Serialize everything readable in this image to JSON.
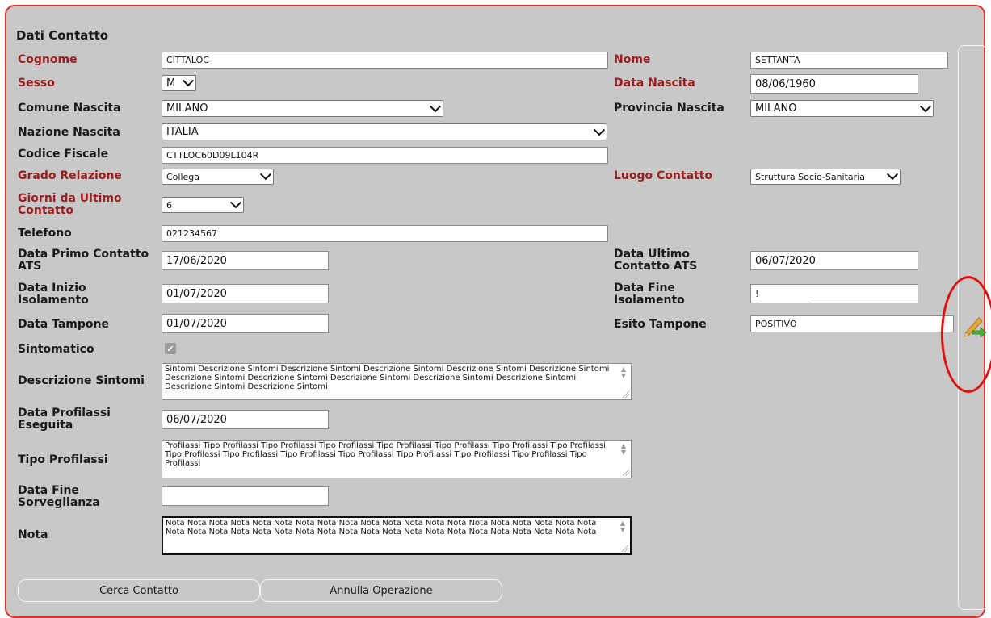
{
  "form": {
    "title": "Dati Contatto",
    "labels": {
      "cognome": "Cognome",
      "nome": "Nome",
      "sesso": "Sesso",
      "data_nascita": "Data Nascita",
      "comune_nascita": "Comune Nascita",
      "provincia_nascita": "Provincia Nascita",
      "nazione_nascita": "Nazione Nascita",
      "codice_fiscale": "Codice Fiscale",
      "grado_relazione": "Grado Relazione",
      "luogo_contatto": "Luogo Contatto",
      "giorni_ultimo_1": "Giorni da Ultimo",
      "giorni_ultimo_2": "Contatto",
      "telefono": "Telefono",
      "data_primo_1": "Data Primo Contatto",
      "data_primo_2": "ATS",
      "data_ultimo_1": "Data Ultimo",
      "data_ultimo_2": "Contatto ATS",
      "data_inizio_1": "Data Inizio",
      "data_inizio_2": "Isolamento",
      "data_fine_1": "Data Fine",
      "data_fine_2": "Isolamento",
      "data_tampone": "Data Tampone",
      "esito_tampone": "Esito Tampone",
      "sintomatico": "Sintomatico",
      "descrizione_sintomi": "Descrizione Sintomi",
      "data_profilassi_1": "Data Profilassi",
      "data_profilassi_2": "Eseguita",
      "tipo_profilassi": "Tipo Profilassi",
      "data_fine_sorv_1": "Data Fine",
      "data_fine_sorv_2": "Sorveglianza",
      "nota": "Nota"
    },
    "values": {
      "cognome": "CITTALOC",
      "nome": "SETTANTA",
      "sesso": "M",
      "data_nascita": "08/06/1960",
      "comune_nascita": "MILANO",
      "provincia_nascita": "MILANO",
      "nazione_nascita": "ITALIA",
      "codice_fiscale": "CTTLOC60D09L104R",
      "grado_relazione": "Collega",
      "luogo_contatto": "Struttura Socio-Sanitaria",
      "giorni_ultimo_contatto": "6",
      "telefono": "021234567",
      "data_primo_contatto": "17/06/2020",
      "data_ultimo_contatto": "06/07/2020",
      "data_inizio_isolamento": "01/07/2020",
      "data_fine_isolamento": "!",
      "data_tampone": "01/07/2020",
      "esito_tampone": "POSITIVO",
      "sintomatico_check": "✔",
      "descrizione_sintomi": "Sintomi Descrizione Sintomi Descrizione Sintomi Descrizione Sintomi Descrizione Sintomi Descrizione Sintomi Descrizione Sintomi Descrizione Sintomi Descrizione Sintomi Descrizione Sintomi Descrizione Sintomi Descrizione Sintomi Descrizione Sintomi",
      "data_profilassi": "06/07/2020",
      "tipo_profilassi": "Profilassi Tipo Profilassi Tipo Profilassi Tipo Profilassi Tipo Profilassi Tipo Profilassi Tipo Profilassi Tipo Profilassi Tipo Profilassi Tipo Profilassi Tipo Profilassi Tipo Profilassi Tipo Profilassi Tipo Profilassi Tipo Profilassi Tipo Profilassi",
      "data_fine_sorveglianza": "",
      "nota": "Nota Nota Nota Nota Nota Nota Nota Nota Nota Nota Nota Nota Nota Nota Nota Nota Nota Nota Nota Nota Nota Nota Nota Nota Nota Nota Nota Nota Nota Nota Nota Nota Nota Nota Nota Nota Nota Nota Nota Nota"
    },
    "textarea_spinner": "▲\n▼",
    "buttons": {
      "cerca": "Cerca Contatto",
      "annulla": "Annulla Operazione"
    }
  },
  "sidebar": {
    "edit_icon": "edit-pencil-arrow-icon"
  },
  "colors": {
    "panel_bg": "#c8c8c8",
    "border_red": "#e03030",
    "required_label": "#9c1d1d",
    "annotation_ring": "#e01010"
  }
}
